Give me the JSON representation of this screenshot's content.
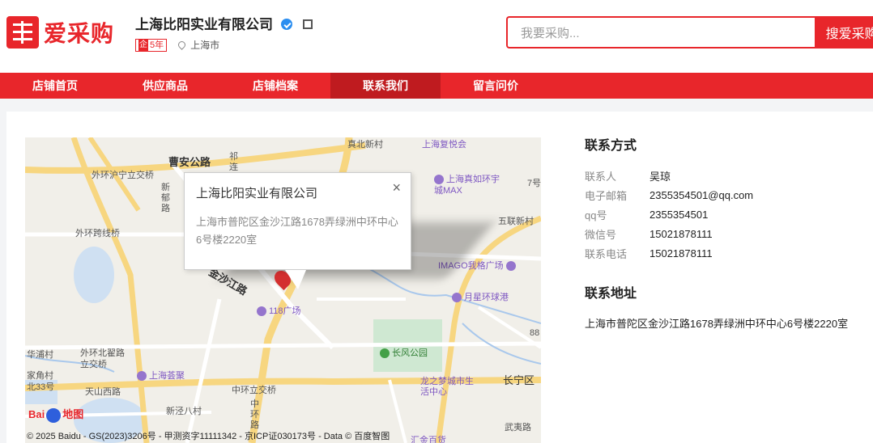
{
  "brand": {
    "name": "爱采购"
  },
  "company": {
    "name": "上海比阳实业有限公司",
    "badge_prefix": "企",
    "badge_years": "5年",
    "city": "上海市"
  },
  "search": {
    "placeholder": "我要采购...",
    "button_label": "搜爱采购"
  },
  "nav": [
    {
      "label": "店铺首页",
      "active": false
    },
    {
      "label": "供应商品",
      "active": false
    },
    {
      "label": "店铺档案",
      "active": false
    },
    {
      "label": "联系我们",
      "active": true
    },
    {
      "label": "留言问价",
      "active": false
    }
  ],
  "map": {
    "popup": {
      "title": "上海比阳实业有限公司",
      "address": "上海市普陀区金沙江路1678弄绿洲中环中心6号楼2220室"
    },
    "labels": [
      "曹安公路",
      "外环沪宁立交桥",
      "新郁路",
      "祁连山南路",
      "外环跨线桥",
      "金沙江路",
      "118广场",
      "上海真如环宇城MAX",
      "五联新村",
      "IMAGO我格广场",
      "月星环球港",
      "长风公园",
      "外环北翟路立交桥",
      "上海荟聚",
      "华浦村",
      "家角村",
      "北33号",
      "天山西路",
      "中环立交桥",
      "新泾八村",
      "中环路",
      "龙之梦城市生活中心",
      "长宁区",
      "汇金百货",
      "武夷路",
      "上海复悦会",
      "真北新村",
      "7号",
      "88"
    ],
    "logo": {
      "left": "Bai",
      "right": "地图"
    },
    "copyright": "© 2025 Baidu - GS(2023)3206号 - 甲测资字11111342 - 京ICP证030173号 - Data © 百度智图"
  },
  "contact": {
    "title": "联系方式",
    "fields": [
      {
        "label": "联系人",
        "value": "吴琼"
      },
      {
        "label": "电子邮箱",
        "value": "2355354501@qq.com"
      },
      {
        "label": "qq号",
        "value": "2355354501"
      },
      {
        "label": "微信号",
        "value": "15021878111"
      },
      {
        "label": "联系电话",
        "value": "15021878111"
      }
    ],
    "address_title": "联系地址",
    "address": "上海市普陀区金沙江路1678弄绿洲中环中心6号楼2220室"
  }
}
